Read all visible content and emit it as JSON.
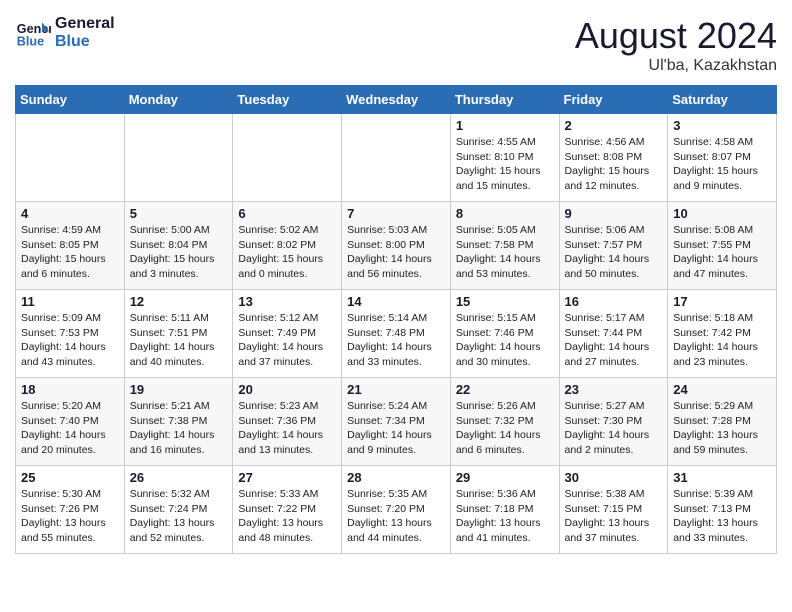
{
  "header": {
    "logo_line1": "General",
    "logo_line2": "Blue",
    "month_year": "August 2024",
    "location": "Ul'ba, Kazakhstan"
  },
  "weekdays": [
    "Sunday",
    "Monday",
    "Tuesday",
    "Wednesday",
    "Thursday",
    "Friday",
    "Saturday"
  ],
  "weeks": [
    [
      {
        "day": "",
        "info": ""
      },
      {
        "day": "",
        "info": ""
      },
      {
        "day": "",
        "info": ""
      },
      {
        "day": "",
        "info": ""
      },
      {
        "day": "1",
        "info": "Sunrise: 4:55 AM\nSunset: 8:10 PM\nDaylight: 15 hours\nand 15 minutes."
      },
      {
        "day": "2",
        "info": "Sunrise: 4:56 AM\nSunset: 8:08 PM\nDaylight: 15 hours\nand 12 minutes."
      },
      {
        "day": "3",
        "info": "Sunrise: 4:58 AM\nSunset: 8:07 PM\nDaylight: 15 hours\nand 9 minutes."
      }
    ],
    [
      {
        "day": "4",
        "info": "Sunrise: 4:59 AM\nSunset: 8:05 PM\nDaylight: 15 hours\nand 6 minutes."
      },
      {
        "day": "5",
        "info": "Sunrise: 5:00 AM\nSunset: 8:04 PM\nDaylight: 15 hours\nand 3 minutes."
      },
      {
        "day": "6",
        "info": "Sunrise: 5:02 AM\nSunset: 8:02 PM\nDaylight: 15 hours\nand 0 minutes."
      },
      {
        "day": "7",
        "info": "Sunrise: 5:03 AM\nSunset: 8:00 PM\nDaylight: 14 hours\nand 56 minutes."
      },
      {
        "day": "8",
        "info": "Sunrise: 5:05 AM\nSunset: 7:58 PM\nDaylight: 14 hours\nand 53 minutes."
      },
      {
        "day": "9",
        "info": "Sunrise: 5:06 AM\nSunset: 7:57 PM\nDaylight: 14 hours\nand 50 minutes."
      },
      {
        "day": "10",
        "info": "Sunrise: 5:08 AM\nSunset: 7:55 PM\nDaylight: 14 hours\nand 47 minutes."
      }
    ],
    [
      {
        "day": "11",
        "info": "Sunrise: 5:09 AM\nSunset: 7:53 PM\nDaylight: 14 hours\nand 43 minutes."
      },
      {
        "day": "12",
        "info": "Sunrise: 5:11 AM\nSunset: 7:51 PM\nDaylight: 14 hours\nand 40 minutes."
      },
      {
        "day": "13",
        "info": "Sunrise: 5:12 AM\nSunset: 7:49 PM\nDaylight: 14 hours\nand 37 minutes."
      },
      {
        "day": "14",
        "info": "Sunrise: 5:14 AM\nSunset: 7:48 PM\nDaylight: 14 hours\nand 33 minutes."
      },
      {
        "day": "15",
        "info": "Sunrise: 5:15 AM\nSunset: 7:46 PM\nDaylight: 14 hours\nand 30 minutes."
      },
      {
        "day": "16",
        "info": "Sunrise: 5:17 AM\nSunset: 7:44 PM\nDaylight: 14 hours\nand 27 minutes."
      },
      {
        "day": "17",
        "info": "Sunrise: 5:18 AM\nSunset: 7:42 PM\nDaylight: 14 hours\nand 23 minutes."
      }
    ],
    [
      {
        "day": "18",
        "info": "Sunrise: 5:20 AM\nSunset: 7:40 PM\nDaylight: 14 hours\nand 20 minutes."
      },
      {
        "day": "19",
        "info": "Sunrise: 5:21 AM\nSunset: 7:38 PM\nDaylight: 14 hours\nand 16 minutes."
      },
      {
        "day": "20",
        "info": "Sunrise: 5:23 AM\nSunset: 7:36 PM\nDaylight: 14 hours\nand 13 minutes."
      },
      {
        "day": "21",
        "info": "Sunrise: 5:24 AM\nSunset: 7:34 PM\nDaylight: 14 hours\nand 9 minutes."
      },
      {
        "day": "22",
        "info": "Sunrise: 5:26 AM\nSunset: 7:32 PM\nDaylight: 14 hours\nand 6 minutes."
      },
      {
        "day": "23",
        "info": "Sunrise: 5:27 AM\nSunset: 7:30 PM\nDaylight: 14 hours\nand 2 minutes."
      },
      {
        "day": "24",
        "info": "Sunrise: 5:29 AM\nSunset: 7:28 PM\nDaylight: 13 hours\nand 59 minutes."
      }
    ],
    [
      {
        "day": "25",
        "info": "Sunrise: 5:30 AM\nSunset: 7:26 PM\nDaylight: 13 hours\nand 55 minutes."
      },
      {
        "day": "26",
        "info": "Sunrise: 5:32 AM\nSunset: 7:24 PM\nDaylight: 13 hours\nand 52 minutes."
      },
      {
        "day": "27",
        "info": "Sunrise: 5:33 AM\nSunset: 7:22 PM\nDaylight: 13 hours\nand 48 minutes."
      },
      {
        "day": "28",
        "info": "Sunrise: 5:35 AM\nSunset: 7:20 PM\nDaylight: 13 hours\nand 44 minutes."
      },
      {
        "day": "29",
        "info": "Sunrise: 5:36 AM\nSunset: 7:18 PM\nDaylight: 13 hours\nand 41 minutes."
      },
      {
        "day": "30",
        "info": "Sunrise: 5:38 AM\nSunset: 7:15 PM\nDaylight: 13 hours\nand 37 minutes."
      },
      {
        "day": "31",
        "info": "Sunrise: 5:39 AM\nSunset: 7:13 PM\nDaylight: 13 hours\nand 33 minutes."
      }
    ]
  ]
}
